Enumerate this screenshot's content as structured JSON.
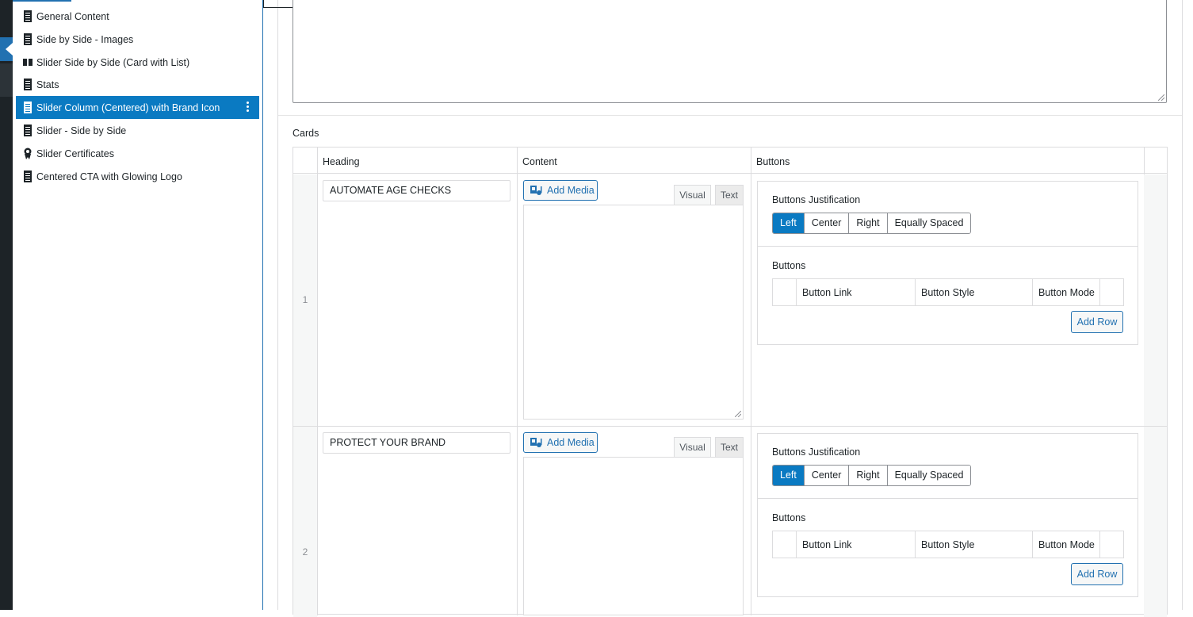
{
  "sidebar": {
    "items": [
      {
        "label": "General Content",
        "icon": "document-icon"
      },
      {
        "label": "Side by Side - Images",
        "icon": "document-icon"
      },
      {
        "label": "Slider Side by Side (Card with List)",
        "icon": "columns-icon"
      },
      {
        "label": "Stats",
        "icon": "document-icon"
      },
      {
        "label": "Slider Column (Centered) with Brand Icon",
        "icon": "document-icon",
        "selected": true
      },
      {
        "label": "Slider - Side by Side",
        "icon": "document-icon"
      },
      {
        "label": "Slider Certificates",
        "icon": "award-icon"
      },
      {
        "label": "Centered CTA with Glowing Logo",
        "icon": "document-icon"
      }
    ]
  },
  "cards": {
    "label": "Cards",
    "columns": {
      "heading": "Heading",
      "content": "Content",
      "buttons": "Buttons"
    },
    "rows": [
      {
        "index": "1",
        "heading_value": "AUTOMATE AGE CHECKS",
        "add_media": "Add Media",
        "tab_visual": "Visual",
        "tab_text": "Text",
        "justification_label": "Buttons Justification",
        "justification_options": [
          "Left",
          "Center",
          "Right",
          "Equally Spaced"
        ],
        "justification_selected": "Left",
        "buttons_label": "Buttons",
        "button_columns": [
          "Button Link",
          "Button Style",
          "Button Mode"
        ],
        "add_row": "Add Row"
      },
      {
        "index": "2",
        "heading_value": "PROTECT YOUR BRAND",
        "add_media": "Add Media",
        "tab_visual": "Visual",
        "tab_text": "Text",
        "justification_label": "Buttons Justification",
        "justification_options": [
          "Left",
          "Center",
          "Right",
          "Equally Spaced"
        ],
        "justification_selected": "Left",
        "buttons_label": "Buttons",
        "button_columns": [
          "Button Link",
          "Button Style",
          "Button Mode"
        ],
        "add_row": "Add Row"
      }
    ]
  },
  "colors": {
    "accent": "#0a7ac2",
    "link": "#2271b1",
    "admin_bar": "#1d2327"
  }
}
